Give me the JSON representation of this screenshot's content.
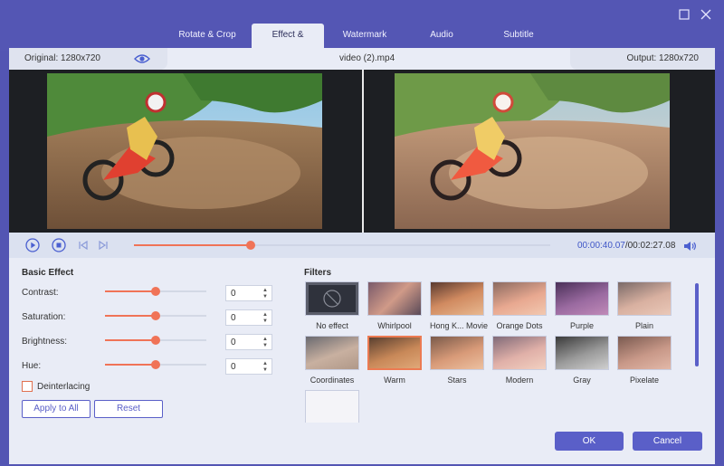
{
  "tabs": [
    {
      "label": "Rotate & Crop"
    },
    {
      "label": "Effect & Filter"
    },
    {
      "label": "Watermark"
    },
    {
      "label": "Audio"
    },
    {
      "label": "Subtitle"
    }
  ],
  "infobar": {
    "original": "Original: 1280x720",
    "filename": "video (2).mp4",
    "output": "Output: 1280x720"
  },
  "playback": {
    "current_time": "00:00:40.07",
    "total_time": "/00:02:27.08",
    "progress": 0.28
  },
  "basic_effect": {
    "title": "Basic Effect",
    "rows": [
      {
        "label": "Contrast:",
        "value": "0",
        "level": 0.5
      },
      {
        "label": "Saturation:",
        "value": "0",
        "level": 0.5
      },
      {
        "label": "Brightness:",
        "value": "0",
        "level": 0.5
      },
      {
        "label": "Hue:",
        "value": "0",
        "level": 0.5
      }
    ],
    "deinterlacing_label": "Deinterlacing",
    "apply_all_label": "Apply to All",
    "reset_label": "Reset"
  },
  "filters": {
    "title": "Filters",
    "selected": "Warm",
    "items": [
      {
        "label": "No effect"
      },
      {
        "label": "Whirlpool"
      },
      {
        "label": "Hong K... Movie"
      },
      {
        "label": "Orange Dots"
      },
      {
        "label": "Purple"
      },
      {
        "label": "Plain"
      },
      {
        "label": "Coordinates"
      },
      {
        "label": "Warm"
      },
      {
        "label": "Stars"
      },
      {
        "label": "Modern"
      },
      {
        "label": "Gray"
      },
      {
        "label": "Pixelate"
      }
    ]
  },
  "footer": {
    "ok_label": "OK",
    "cancel_label": "Cancel"
  },
  "colors": {
    "accent": "#5a5fc8",
    "slider": "#f07357",
    "chrome": "#5456b4"
  }
}
